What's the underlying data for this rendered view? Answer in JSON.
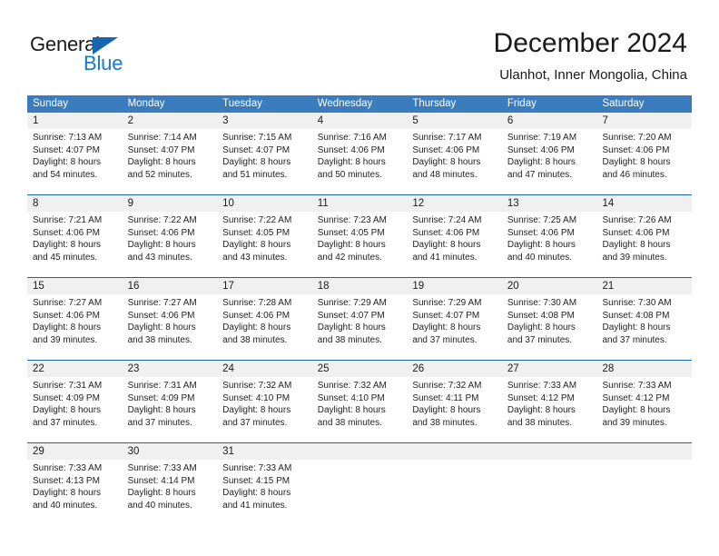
{
  "brand": {
    "name_part1": "General",
    "name_part2": "Blue",
    "triangle_color": "#1567b0",
    "blue_color": "#1878c8"
  },
  "header": {
    "title": "December 2024",
    "subtitle": "Ulanhot, Inner Mongolia, China"
  },
  "colors": {
    "header_band": "#3b7cbe",
    "day_number_band": "#f0f0f0",
    "divider": "#1567b0"
  },
  "weekdays": [
    "Sunday",
    "Monday",
    "Tuesday",
    "Wednesday",
    "Thursday",
    "Friday",
    "Saturday"
  ],
  "weeks": [
    [
      {
        "day": "1",
        "sunrise": "Sunrise: 7:13 AM",
        "sunset": "Sunset: 4:07 PM",
        "daylight1": "Daylight: 8 hours",
        "daylight2": "and 54 minutes."
      },
      {
        "day": "2",
        "sunrise": "Sunrise: 7:14 AM",
        "sunset": "Sunset: 4:07 PM",
        "daylight1": "Daylight: 8 hours",
        "daylight2": "and 52 minutes."
      },
      {
        "day": "3",
        "sunrise": "Sunrise: 7:15 AM",
        "sunset": "Sunset: 4:07 PM",
        "daylight1": "Daylight: 8 hours",
        "daylight2": "and 51 minutes."
      },
      {
        "day": "4",
        "sunrise": "Sunrise: 7:16 AM",
        "sunset": "Sunset: 4:06 PM",
        "daylight1": "Daylight: 8 hours",
        "daylight2": "and 50 minutes."
      },
      {
        "day": "5",
        "sunrise": "Sunrise: 7:17 AM",
        "sunset": "Sunset: 4:06 PM",
        "daylight1": "Daylight: 8 hours",
        "daylight2": "and 48 minutes."
      },
      {
        "day": "6",
        "sunrise": "Sunrise: 7:19 AM",
        "sunset": "Sunset: 4:06 PM",
        "daylight1": "Daylight: 8 hours",
        "daylight2": "and 47 minutes."
      },
      {
        "day": "7",
        "sunrise": "Sunrise: 7:20 AM",
        "sunset": "Sunset: 4:06 PM",
        "daylight1": "Daylight: 8 hours",
        "daylight2": "and 46 minutes."
      }
    ],
    [
      {
        "day": "8",
        "sunrise": "Sunrise: 7:21 AM",
        "sunset": "Sunset: 4:06 PM",
        "daylight1": "Daylight: 8 hours",
        "daylight2": "and 45 minutes."
      },
      {
        "day": "9",
        "sunrise": "Sunrise: 7:22 AM",
        "sunset": "Sunset: 4:06 PM",
        "daylight1": "Daylight: 8 hours",
        "daylight2": "and 43 minutes."
      },
      {
        "day": "10",
        "sunrise": "Sunrise: 7:22 AM",
        "sunset": "Sunset: 4:05 PM",
        "daylight1": "Daylight: 8 hours",
        "daylight2": "and 43 minutes."
      },
      {
        "day": "11",
        "sunrise": "Sunrise: 7:23 AM",
        "sunset": "Sunset: 4:05 PM",
        "daylight1": "Daylight: 8 hours",
        "daylight2": "and 42 minutes."
      },
      {
        "day": "12",
        "sunrise": "Sunrise: 7:24 AM",
        "sunset": "Sunset: 4:06 PM",
        "daylight1": "Daylight: 8 hours",
        "daylight2": "and 41 minutes."
      },
      {
        "day": "13",
        "sunrise": "Sunrise: 7:25 AM",
        "sunset": "Sunset: 4:06 PM",
        "daylight1": "Daylight: 8 hours",
        "daylight2": "and 40 minutes."
      },
      {
        "day": "14",
        "sunrise": "Sunrise: 7:26 AM",
        "sunset": "Sunset: 4:06 PM",
        "daylight1": "Daylight: 8 hours",
        "daylight2": "and 39 minutes."
      }
    ],
    [
      {
        "day": "15",
        "sunrise": "Sunrise: 7:27 AM",
        "sunset": "Sunset: 4:06 PM",
        "daylight1": "Daylight: 8 hours",
        "daylight2": "and 39 minutes."
      },
      {
        "day": "16",
        "sunrise": "Sunrise: 7:27 AM",
        "sunset": "Sunset: 4:06 PM",
        "daylight1": "Daylight: 8 hours",
        "daylight2": "and 38 minutes."
      },
      {
        "day": "17",
        "sunrise": "Sunrise: 7:28 AM",
        "sunset": "Sunset: 4:06 PM",
        "daylight1": "Daylight: 8 hours",
        "daylight2": "and 38 minutes."
      },
      {
        "day": "18",
        "sunrise": "Sunrise: 7:29 AM",
        "sunset": "Sunset: 4:07 PM",
        "daylight1": "Daylight: 8 hours",
        "daylight2": "and 38 minutes."
      },
      {
        "day": "19",
        "sunrise": "Sunrise: 7:29 AM",
        "sunset": "Sunset: 4:07 PM",
        "daylight1": "Daylight: 8 hours",
        "daylight2": "and 37 minutes."
      },
      {
        "day": "20",
        "sunrise": "Sunrise: 7:30 AM",
        "sunset": "Sunset: 4:08 PM",
        "daylight1": "Daylight: 8 hours",
        "daylight2": "and 37 minutes."
      },
      {
        "day": "21",
        "sunrise": "Sunrise: 7:30 AM",
        "sunset": "Sunset: 4:08 PM",
        "daylight1": "Daylight: 8 hours",
        "daylight2": "and 37 minutes."
      }
    ],
    [
      {
        "day": "22",
        "sunrise": "Sunrise: 7:31 AM",
        "sunset": "Sunset: 4:09 PM",
        "daylight1": "Daylight: 8 hours",
        "daylight2": "and 37 minutes."
      },
      {
        "day": "23",
        "sunrise": "Sunrise: 7:31 AM",
        "sunset": "Sunset: 4:09 PM",
        "daylight1": "Daylight: 8 hours",
        "daylight2": "and 37 minutes."
      },
      {
        "day": "24",
        "sunrise": "Sunrise: 7:32 AM",
        "sunset": "Sunset: 4:10 PM",
        "daylight1": "Daylight: 8 hours",
        "daylight2": "and 37 minutes."
      },
      {
        "day": "25",
        "sunrise": "Sunrise: 7:32 AM",
        "sunset": "Sunset: 4:10 PM",
        "daylight1": "Daylight: 8 hours",
        "daylight2": "and 38 minutes."
      },
      {
        "day": "26",
        "sunrise": "Sunrise: 7:32 AM",
        "sunset": "Sunset: 4:11 PM",
        "daylight1": "Daylight: 8 hours",
        "daylight2": "and 38 minutes."
      },
      {
        "day": "27",
        "sunrise": "Sunrise: 7:33 AM",
        "sunset": "Sunset: 4:12 PM",
        "daylight1": "Daylight: 8 hours",
        "daylight2": "and 38 minutes."
      },
      {
        "day": "28",
        "sunrise": "Sunrise: 7:33 AM",
        "sunset": "Sunset: 4:12 PM",
        "daylight1": "Daylight: 8 hours",
        "daylight2": "and 39 minutes."
      }
    ],
    [
      {
        "day": "29",
        "sunrise": "Sunrise: 7:33 AM",
        "sunset": "Sunset: 4:13 PM",
        "daylight1": "Daylight: 8 hours",
        "daylight2": "and 40 minutes."
      },
      {
        "day": "30",
        "sunrise": "Sunrise: 7:33 AM",
        "sunset": "Sunset: 4:14 PM",
        "daylight1": "Daylight: 8 hours",
        "daylight2": "and 40 minutes."
      },
      {
        "day": "31",
        "sunrise": "Sunrise: 7:33 AM",
        "sunset": "Sunset: 4:15 PM",
        "daylight1": "Daylight: 8 hours",
        "daylight2": "and 41 minutes."
      },
      {
        "day": "",
        "sunrise": "",
        "sunset": "",
        "daylight1": "",
        "daylight2": ""
      },
      {
        "day": "",
        "sunrise": "",
        "sunset": "",
        "daylight1": "",
        "daylight2": ""
      },
      {
        "day": "",
        "sunrise": "",
        "sunset": "",
        "daylight1": "",
        "daylight2": ""
      },
      {
        "day": "",
        "sunrise": "",
        "sunset": "",
        "daylight1": "",
        "daylight2": ""
      }
    ]
  ]
}
